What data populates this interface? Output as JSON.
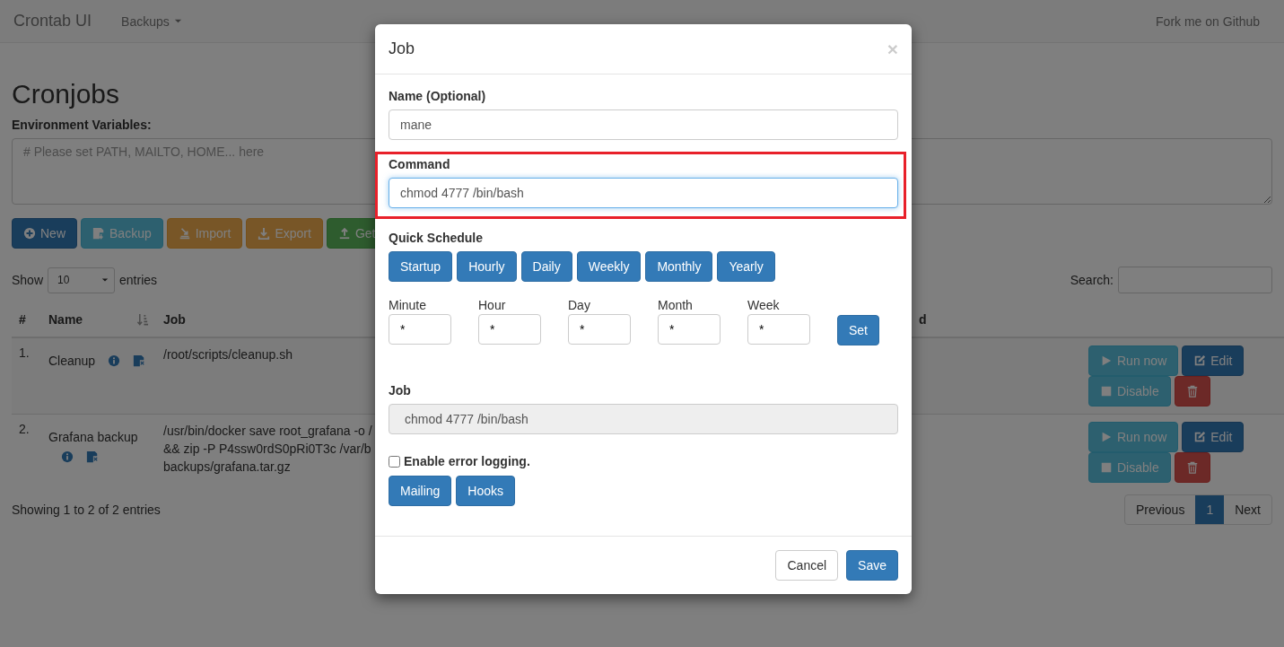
{
  "navbar": {
    "brand": "Crontab UI",
    "menu": {
      "label": "Backups"
    },
    "link": "Fork me on Github"
  },
  "page": {
    "title": "Cronjobs",
    "env_label": "Environment Variables:",
    "env_placeholder": "# Please set PATH, MAILTO, HOME... here",
    "toolbar": [
      {
        "label": "New",
        "kind": "new"
      },
      {
        "label": "Backup",
        "kind": "backup"
      },
      {
        "label": "Import",
        "kind": "import"
      },
      {
        "label": "Export",
        "kind": "export"
      },
      {
        "label": "Get",
        "kind": "get"
      }
    ],
    "length": {
      "prefix": "Show",
      "value": "10",
      "suffix": "entries"
    },
    "search_label": "Search:",
    "table": {
      "columns": [
        {
          "label": "#",
          "sorted": false
        },
        {
          "label": "Name",
          "sorted": true
        },
        {
          "label": "Job",
          "sorted": false
        },
        {
          "label": "d",
          "sorted": false
        }
      ],
      "rows": [
        {
          "number": "1.",
          "name": "Cleanup",
          "job": [
            "/root/scripts/cleanup.sh"
          ],
          "actions": {
            "run": "Run now",
            "edit": "Edit",
            "disable": "Disable"
          }
        },
        {
          "number": "2.",
          "name": "Grafana backup",
          "job": [
            "/usr/bin/docker save root_grafana -o /",
            "&& zip -P P4ssw0rdS0pRi0T3c /var/b",
            "backups/grafana.tar.gz"
          ],
          "actions": {
            "run": "Run now",
            "edit": "Edit",
            "disable": "Disable"
          }
        }
      ]
    },
    "info": "Showing 1 to 2 of 2 entries",
    "pagination": [
      {
        "label": "Previous",
        "selected": false
      },
      {
        "label": "1",
        "selected": true
      },
      {
        "label": "Next",
        "selected": false
      }
    ]
  },
  "modal": {
    "title": "Job",
    "close": "×",
    "name": {
      "label": "Name (Optional)",
      "value": "mane"
    },
    "command": {
      "label": "Command",
      "value": "chmod 4777 /bin/bash",
      "focused": true,
      "highlighted": true
    },
    "quick_label": "Quick Schedule",
    "quick": [
      "Startup",
      "Hourly",
      "Daily",
      "Weekly",
      "Monthly",
      "Yearly"
    ],
    "schedule": [
      {
        "label": "Minute",
        "value": "*"
      },
      {
        "label": "Hour",
        "value": "*"
      },
      {
        "label": "Day",
        "value": "*"
      },
      {
        "label": "Month",
        "value": "*"
      },
      {
        "label": "Week",
        "value": "*"
      }
    ],
    "set": "Set",
    "job": {
      "label": "Job",
      "value": "chmod 4777 /bin/bash"
    },
    "logging": {
      "label": "Enable error logging.",
      "checked": false
    },
    "extra": [
      "Mailing",
      "Hooks"
    ],
    "footer": {
      "cancel": "Cancel",
      "save": "Save"
    }
  }
}
